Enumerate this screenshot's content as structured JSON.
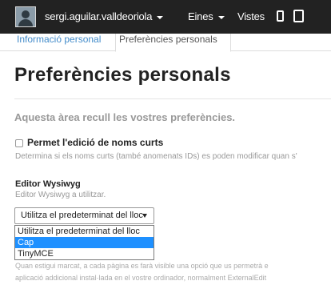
{
  "navbar": {
    "username": "sergi.aguilar.valldeoriola",
    "menu_tools": "Eines",
    "menu_views": "Vistes",
    "icons": [
      "user-avatar-icon",
      "caret-down-icon",
      "phone-icon",
      "tablet-icon"
    ]
  },
  "tabs": [
    {
      "label": "Informació personal",
      "active": false
    },
    {
      "label": "Preferències personals",
      "active": true
    }
  ],
  "page": {
    "title": "Preferències personals",
    "lead": "Aquesta àrea recull les vostres preferències."
  },
  "short_names": {
    "label": "Permet l'edició de noms curts",
    "checked": false,
    "help": "Determina si els noms curts (també anomenats IDs) es poden modificar quan s'"
  },
  "wysiwyg": {
    "label": "Editor Wysiwyg",
    "help": "Editor Wysiwyg a utilitzar.",
    "selected_value": "Utilitza el predeterminat del lloc",
    "options": [
      "Utilitza el predeterminat del lloc",
      "Cap",
      "TinyMCE"
    ],
    "highlighted_index": 1
  },
  "external_editor": {
    "help_line1": "Quan estigui marcat, a cada pàgina es farà visible una opció que us permetrà e",
    "help_line2": "aplicació addicional instal·lada en el vostre ordinador, normalment ExternalEdit"
  },
  "colors": {
    "navbar_bg": "#222222",
    "link": "#428bca",
    "highlight": "#1e90ff"
  }
}
